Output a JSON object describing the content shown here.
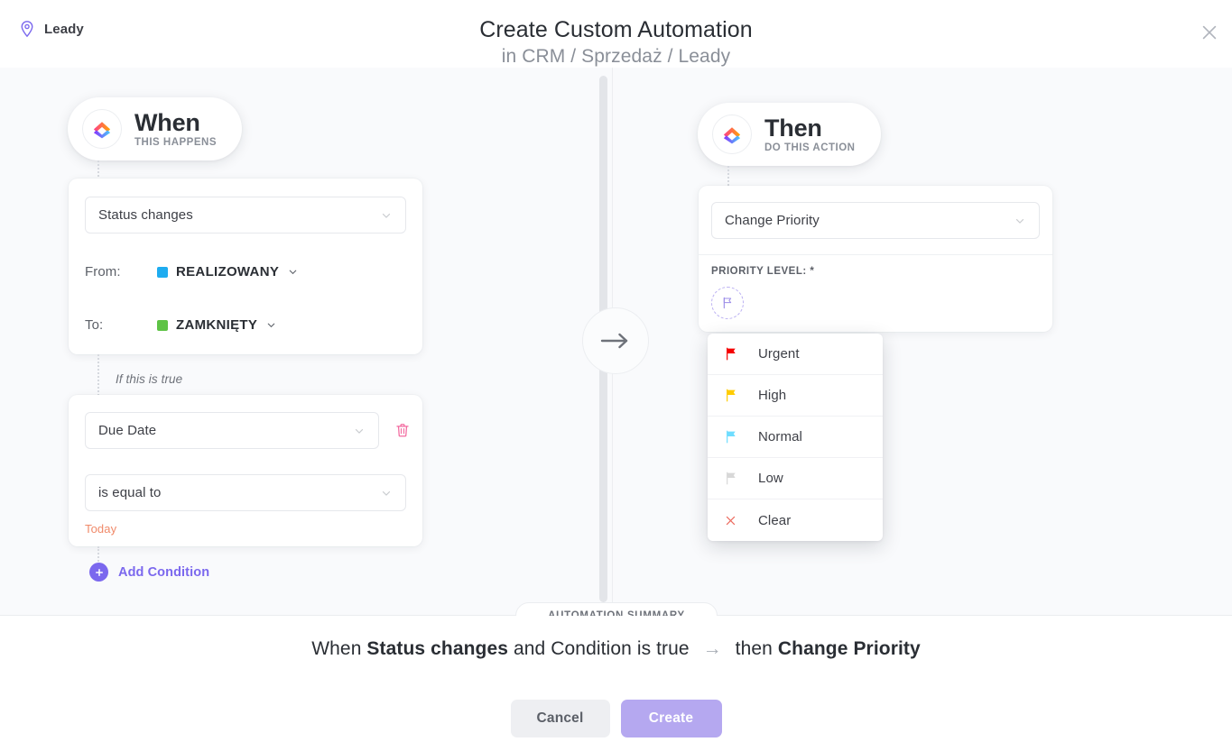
{
  "header": {
    "brand_label": "Leady",
    "brand_icon": "location-pin-icon",
    "title": "Create Custom Automation",
    "subtitle": "in CRM / Sprzedaż / Leady",
    "close_icon": "close-icon"
  },
  "when": {
    "pill_title": "When",
    "pill_subtitle": "THIS HAPPENS",
    "logo_icon": "clickup-logo-icon",
    "trigger_value": "Status changes",
    "from_label": "From:",
    "from_status": "REALIZOWANY",
    "from_color": "#1eacf0",
    "to_label": "To:",
    "to_status": "ZAMKNIĘTY",
    "to_color": "#5ec346",
    "if_true_label": "If this is true",
    "condition_field": "Due Date",
    "condition_operator": "is equal to",
    "condition_value": "Today",
    "delete_icon": "trash-icon",
    "add_condition_label": "Add Condition",
    "add_condition_icon": "plus-circle-icon"
  },
  "middle": {
    "arrow_icon": "arrow-right-icon"
  },
  "then": {
    "pill_title": "Then",
    "pill_subtitle": "DO THIS ACTION",
    "logo_icon": "clickup-logo-icon",
    "action_value": "Change Priority",
    "priority_label": "PRIORITY LEVEL: *",
    "priority_placeholder_icon": "flag-outline-icon",
    "dropdown": {
      "items": [
        {
          "label": "Urgent",
          "icon": "flag-icon",
          "color": "#f50000"
        },
        {
          "label": "High",
          "icon": "flag-icon",
          "color": "#ffcc00"
        },
        {
          "label": "Normal",
          "icon": "flag-icon",
          "color": "#6fddff"
        },
        {
          "label": "Low",
          "icon": "flag-icon",
          "color": "#d8d8d8"
        },
        {
          "label": "Clear",
          "icon": "clear-x-icon",
          "color": "#ec6a5e"
        }
      ]
    }
  },
  "summary": {
    "pill_label": "AUTOMATION SUMMARY",
    "prefix": "When ",
    "trigger": "Status changes",
    "middle_text": " and Condition is true ",
    "arrow": "→",
    "then_prefix": " then ",
    "action": "Change Priority"
  },
  "footer": {
    "cancel_label": "Cancel",
    "create_label": "Create"
  },
  "colors": {
    "accent_purple": "#7b68ee",
    "body_bg": "#f9fafc",
    "create_btn": "#b5a8f0"
  }
}
